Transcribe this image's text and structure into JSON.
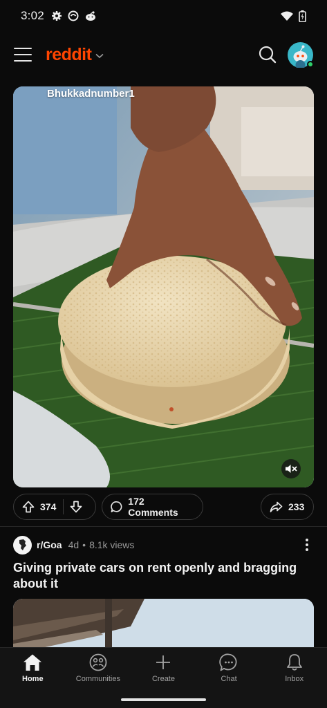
{
  "status_bar": {
    "time": "3:02"
  },
  "header": {
    "brand": "reddit"
  },
  "post": {
    "watermark": "Bhukkadnumber1",
    "upvotes": "374",
    "comments_label": "172 Comments",
    "shares": "233"
  },
  "next_post": {
    "subreddit": "r/Goa",
    "age": "4d",
    "separator": "•",
    "views": "8.1k views",
    "title": "Giving private cars on rent openly and bragging about it"
  },
  "bottom_nav": [
    {
      "label": "Home",
      "icon": "home-icon",
      "active": true
    },
    {
      "label": "Communities",
      "icon": "communities-icon",
      "active": false
    },
    {
      "label": "Create",
      "icon": "plus-icon",
      "active": false
    },
    {
      "label": "Chat",
      "icon": "chat-icon",
      "active": false
    },
    {
      "label": "Inbox",
      "icon": "bell-icon",
      "active": false
    }
  ],
  "colors": {
    "brand": "#ff4500",
    "background": "#0b0b0b",
    "online": "#2fd06a",
    "avatar": "#39b7c8"
  }
}
